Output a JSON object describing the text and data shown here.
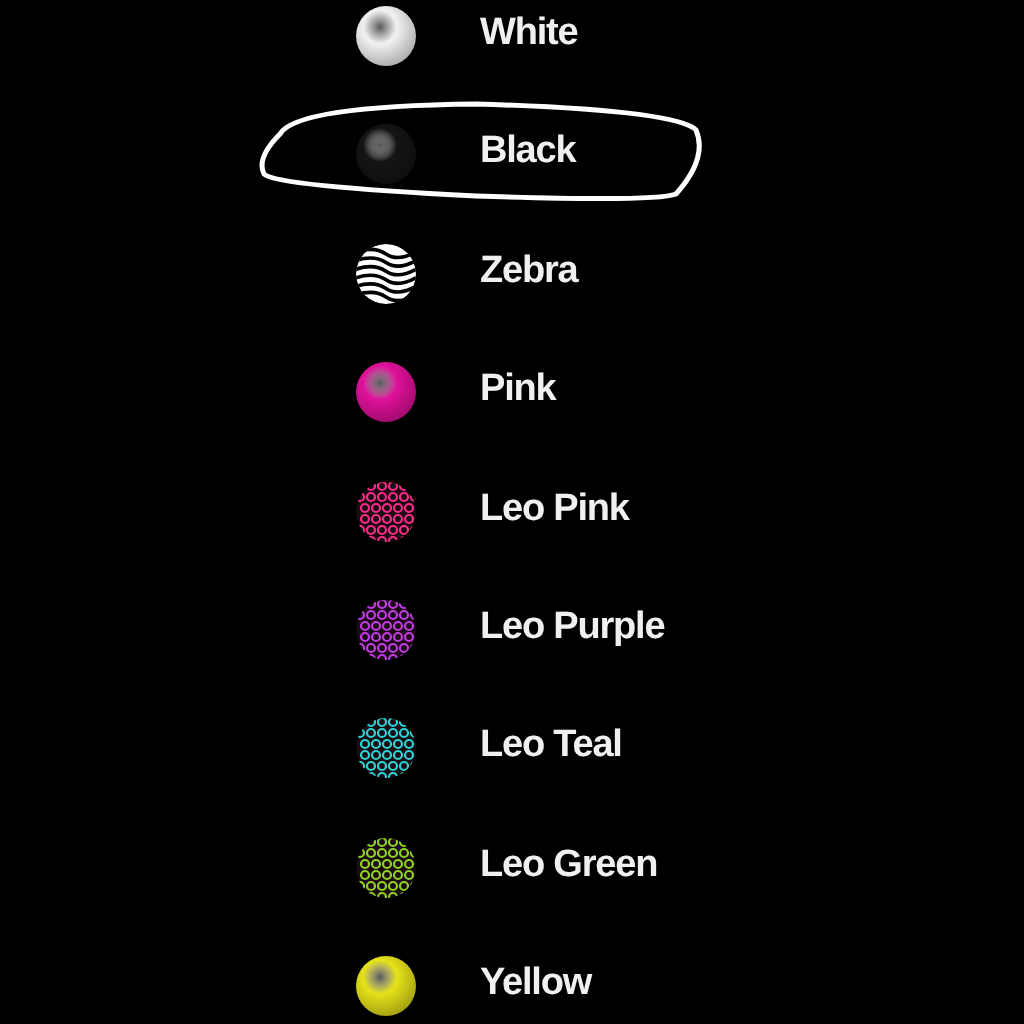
{
  "options": [
    {
      "label": "White",
      "kind": "solid",
      "color": "#f2f2f2",
      "selected": false
    },
    {
      "label": "Black",
      "kind": "solid",
      "color": "#141414",
      "selected": true
    },
    {
      "label": "Zebra",
      "kind": "stripes",
      "color": "#ffffff",
      "selected": false
    },
    {
      "label": "Pink",
      "kind": "solid",
      "color": "#e0109a",
      "selected": false
    },
    {
      "label": "Leo Pink",
      "kind": "leopard",
      "color": "#ff2a8a",
      "selected": false
    },
    {
      "label": "Leo Purple",
      "kind": "leopard",
      "color": "#c23ae6",
      "selected": false
    },
    {
      "label": "Leo Teal",
      "kind": "leopard",
      "color": "#2ad4d4",
      "selected": false
    },
    {
      "label": "Leo Green",
      "kind": "leopard",
      "color": "#8ed21e",
      "selected": false
    },
    {
      "label": "Yellow",
      "kind": "solid",
      "color": "#e6e21a",
      "selected": false
    }
  ]
}
